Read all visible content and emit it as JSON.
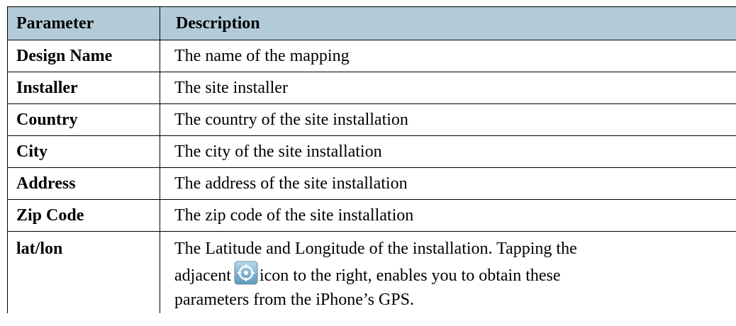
{
  "table": {
    "header": {
      "parameter": "Parameter",
      "description": "Description"
    },
    "rows": [
      {
        "parameter": "Design Name",
        "description": "The name of the mapping"
      },
      {
        "parameter": "Installer",
        "description": "The site installer"
      },
      {
        "parameter": "Country",
        "description": "The country of the site installation"
      },
      {
        "parameter": "City",
        "description": "The city of the site installation"
      },
      {
        "parameter": "Address",
        "description": "The address of the site installation"
      },
      {
        "parameter": "Zip Code",
        "description": "The zip code of the site installation"
      },
      {
        "parameter": "lat/lon",
        "description_line1": "The Latitude and Longitude of the installation. Tapping the",
        "description_line2_before_icon": "adjacent",
        "description_icon": "gps-locate-icon",
        "description_line2_after_icon": "icon to the right, enables you to obtain these",
        "description_line3": "parameters from the iPhone’s GPS."
      }
    ]
  },
  "colors": {
    "header_background": "#b3cbd9",
    "border": "#000000",
    "icon_ring": "#ffffff",
    "icon_background": "#7fb2cf"
  }
}
